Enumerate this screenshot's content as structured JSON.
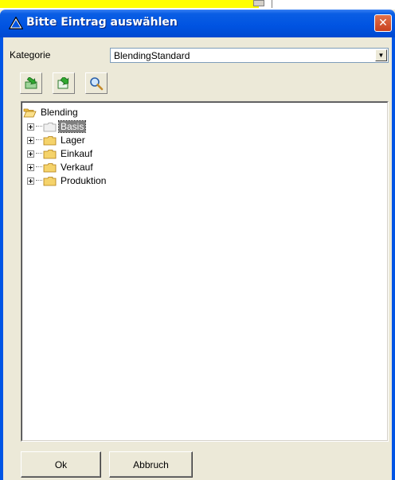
{
  "dialog": {
    "title": "Bitte Eintrag auswählen",
    "close_label": "✕"
  },
  "category": {
    "label": "Kategorie",
    "selected": "BlendingStandard"
  },
  "toolbar": {
    "buttons": [
      {
        "icon": "import-icon"
      },
      {
        "icon": "export-icon"
      },
      {
        "icon": "search-icon"
      }
    ]
  },
  "tree": {
    "root": "Blending",
    "children": [
      {
        "label": "Basis",
        "selected": true
      },
      {
        "label": "Lager",
        "selected": false
      },
      {
        "label": "Einkauf",
        "selected": false
      },
      {
        "label": "Verkauf",
        "selected": false
      },
      {
        "label": "Produktion",
        "selected": false
      }
    ]
  },
  "buttons": {
    "ok": "Ok",
    "cancel": "Abbruch"
  },
  "colors": {
    "titlebar": "#0053e1",
    "frame": "#0055e5",
    "dialog_bg": "#ece9d8",
    "folder": "#f5d36b",
    "selection": "#808080"
  }
}
